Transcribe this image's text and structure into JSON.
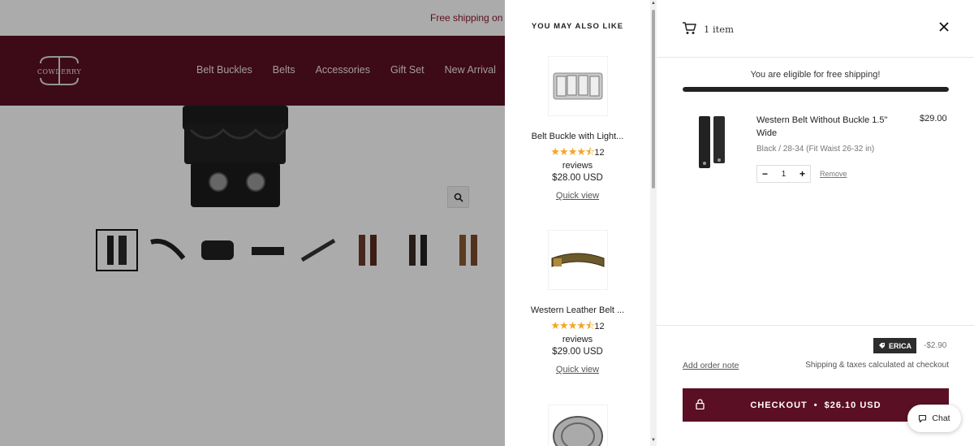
{
  "announcement": "Free shipping on",
  "brand": {
    "logo_text": "COWDERRY"
  },
  "nav": [
    "Belt Buckles",
    "Belts",
    "Accessories",
    "Gift Set",
    "New Arrival"
  ],
  "upsell": {
    "title": "YOU MAY ALSO LIKE",
    "items": [
      {
        "name": "Belt Buckle with Light...",
        "rating_count": "12",
        "reviews_label": "reviews",
        "price": "$28.00 USD",
        "quick_view": "Quick view",
        "stars": "★★★★⯪"
      },
      {
        "name": "Western Leather Belt ...",
        "rating_count": "12",
        "reviews_label": "reviews",
        "price": "$29.00 USD",
        "quick_view": "Quick view",
        "stars": "★★★★⯪"
      }
    ]
  },
  "cart": {
    "count_label": "1 item",
    "shipping_message": "You are eligible for free shipping!",
    "shipping_progress": 1.0,
    "item": {
      "title": "Western Belt Without Buckle 1.5\" Wide",
      "price": "$29.00",
      "variant": "Black / 28-34 (Fit Waist 26-32 in)",
      "quantity": "1",
      "minus": "−",
      "plus": "+",
      "remove": "Remove"
    },
    "discount_code": "ERICA",
    "discount_amount": "-$2.90",
    "order_note": "Add order note",
    "shipping_note": "Shipping & taxes calculated at checkout",
    "checkout_label": "CHECKOUT",
    "checkout_total": "$26.10 USD"
  },
  "chat_label": "Chat",
  "colors": {
    "brand": "#5b0f24",
    "star": "#f5a623"
  }
}
